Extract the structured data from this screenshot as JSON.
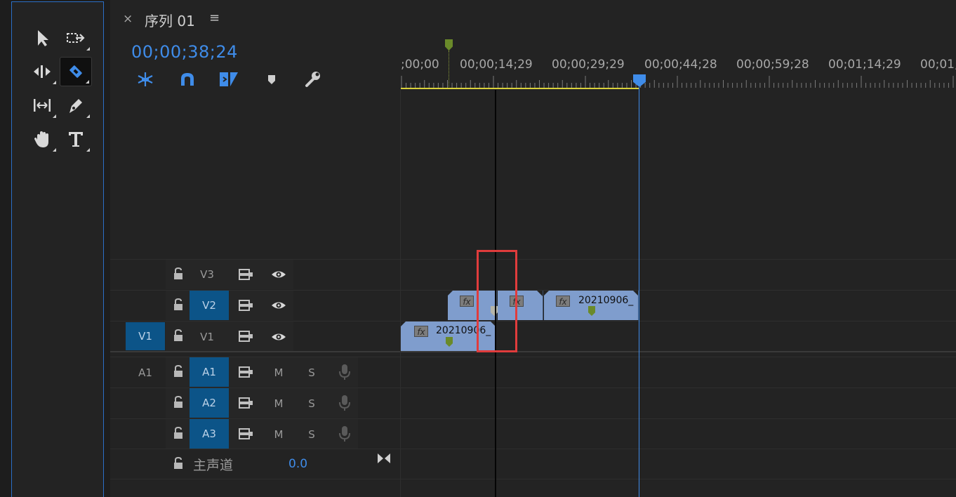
{
  "sequence_tab": {
    "close_label": "×",
    "title": "序列 01",
    "menu_label": "≡"
  },
  "timecode": "00;00;38;24",
  "toolbar_icons": [
    "snap-icon",
    "linked-selection-icon",
    "insert-overwrite-icon",
    "add-marker-icon",
    "timeline-settings-icon"
  ],
  "tools": [
    "selection-tool",
    "track-select-forward-tool",
    "ripple-edit-tool",
    "razor-tool",
    "slip-tool",
    "pen-tool",
    "hand-tool",
    "type-tool"
  ],
  "active_tool": "razor-tool",
  "ruler_labels": [
    ";00;00",
    "00;00;14;29",
    "00;00;29;29",
    "00;00;44;28",
    "00;00;59;28",
    "00;01;14;29",
    "00;01;"
  ],
  "tracks": {
    "video": [
      {
        "source": "",
        "name": "V3",
        "targeted": false
      },
      {
        "source": "",
        "name": "V2",
        "targeted": true
      },
      {
        "source": "V1",
        "name": "V1",
        "targeted": false
      }
    ],
    "audio": [
      {
        "source": "A1",
        "name": "A1",
        "targeted": true,
        "mute": "M",
        "solo": "S"
      },
      {
        "source": "",
        "name": "A2",
        "targeted": true,
        "mute": "M",
        "solo": "S"
      },
      {
        "source": "",
        "name": "A3",
        "targeted": true,
        "mute": "M",
        "solo": "S"
      }
    ],
    "master": {
      "label": "主声道",
      "value": "0.0"
    }
  },
  "clips": {
    "v2_clip_a_label": "",
    "v2_clip_b_label": "",
    "v2_clip_c_label": "20210906_",
    "v1_clip_label": "20210906_",
    "fx_label": "fx"
  },
  "colors": {
    "accent": "#3f8ce9",
    "target": "#0c5488",
    "clip": "#7f9dcd",
    "highlight": "#e03c3c"
  }
}
